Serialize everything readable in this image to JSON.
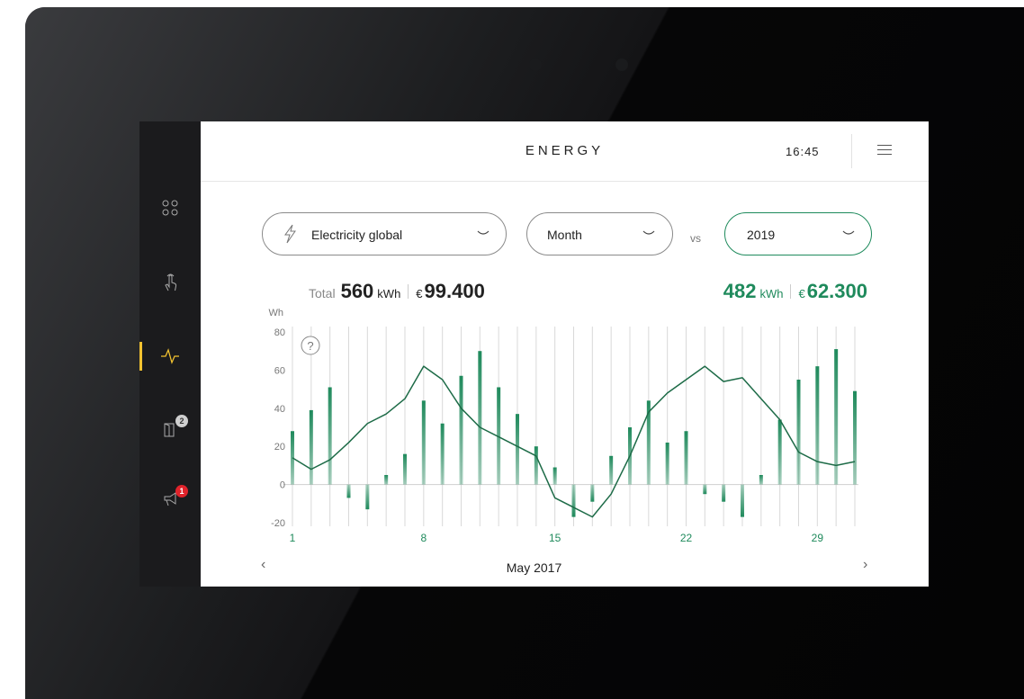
{
  "header": {
    "title": "ENERGY",
    "time": "16:45"
  },
  "sidebar": {
    "items": [
      {
        "id": "apps",
        "icon": "apps-grid-icon"
      },
      {
        "id": "touch",
        "icon": "touch-hand-icon"
      },
      {
        "id": "energy",
        "icon": "energy-wave-icon",
        "active": true
      },
      {
        "id": "door",
        "icon": "door-icon",
        "badge": "2"
      },
      {
        "id": "alarm",
        "icon": "alarm-megaphone-icon",
        "badge": "1"
      }
    ],
    "accent": "#f2c230"
  },
  "filters": {
    "source": "Electricity global",
    "period": "Month",
    "vs_label": "vs",
    "compare": "2019"
  },
  "totals": {
    "label": "Total",
    "energy": "560",
    "energy_unit": "kWh",
    "currency": "€",
    "cost": "99.400",
    "compare_energy": "482",
    "compare_energy_unit": "kWh",
    "compare_currency": "€",
    "compare_cost": "62.300"
  },
  "chart_data": {
    "type": "bar",
    "ylabel": "Wh",
    "ylim": [
      -20,
      80
    ],
    "yticks": [
      80,
      60,
      40,
      20,
      0,
      -20
    ],
    "x": [
      1,
      2,
      3,
      4,
      5,
      6,
      7,
      8,
      9,
      10,
      11,
      12,
      13,
      14,
      15,
      16,
      17,
      18,
      19,
      20,
      21,
      22,
      23,
      24,
      25,
      26,
      27,
      28,
      29,
      30,
      31
    ],
    "xtick_labels": [
      "1",
      "8",
      "15",
      "22",
      "29"
    ],
    "xtick_positions": [
      1,
      8,
      15,
      22,
      29
    ],
    "series": [
      {
        "values": [
          28,
          39,
          51,
          -7,
          -13,
          5,
          16,
          44,
          32,
          57,
          70,
          51,
          37,
          20,
          9,
          -17,
          -9,
          15,
          30,
          44,
          22,
          28,
          -5,
          -9,
          -17,
          5,
          34,
          55,
          62,
          71,
          49
        ]
      },
      {
        "type": "line",
        "values": [
          14,
          8,
          13,
          22,
          32,
          37,
          45,
          62,
          55,
          40,
          30,
          25,
          20,
          15,
          -7,
          -12,
          -17,
          -5,
          15,
          38,
          48,
          55,
          62,
          54,
          56,
          45,
          34,
          17,
          12,
          10,
          12
        ]
      }
    ],
    "colors": {
      "bar": "#1f8a5c",
      "line": "#1d6b47"
    },
    "help_icon": "question-icon",
    "period_label": "May 2017"
  }
}
